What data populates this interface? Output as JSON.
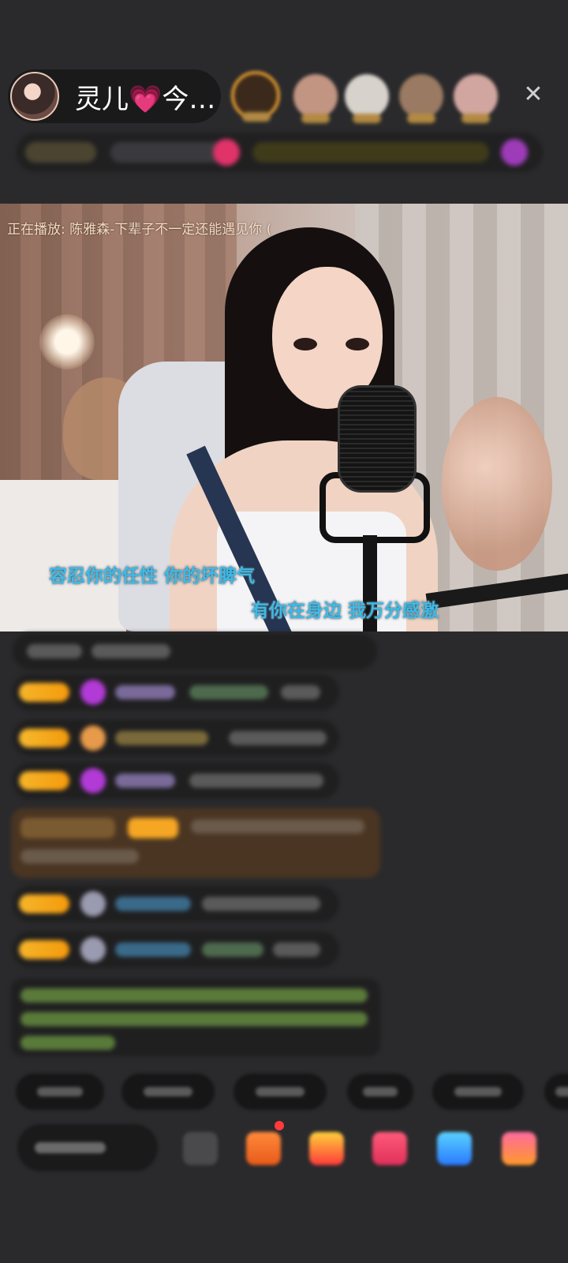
{
  "host": {
    "name": "灵儿💗今…",
    "close_symbol": "✕"
  },
  "video": {
    "now_playing": "正在播放: 陈雅森-下辈子不一定还能遇见你 (",
    "lyric_line_1": "容忍你的任性  你的坏脾气",
    "lyric_line_2": "有你在身边  我万分感激"
  },
  "colors": {
    "accent_orange": "#f5a623",
    "lyric_blue": "#3fb9e6",
    "chat_bubble": "#1f1f20",
    "background": "#2a2a2c"
  },
  "icons": {
    "close": "close-icon",
    "gift": "gift-icon",
    "emoji": "emoji-icon",
    "more": "more-icon"
  }
}
